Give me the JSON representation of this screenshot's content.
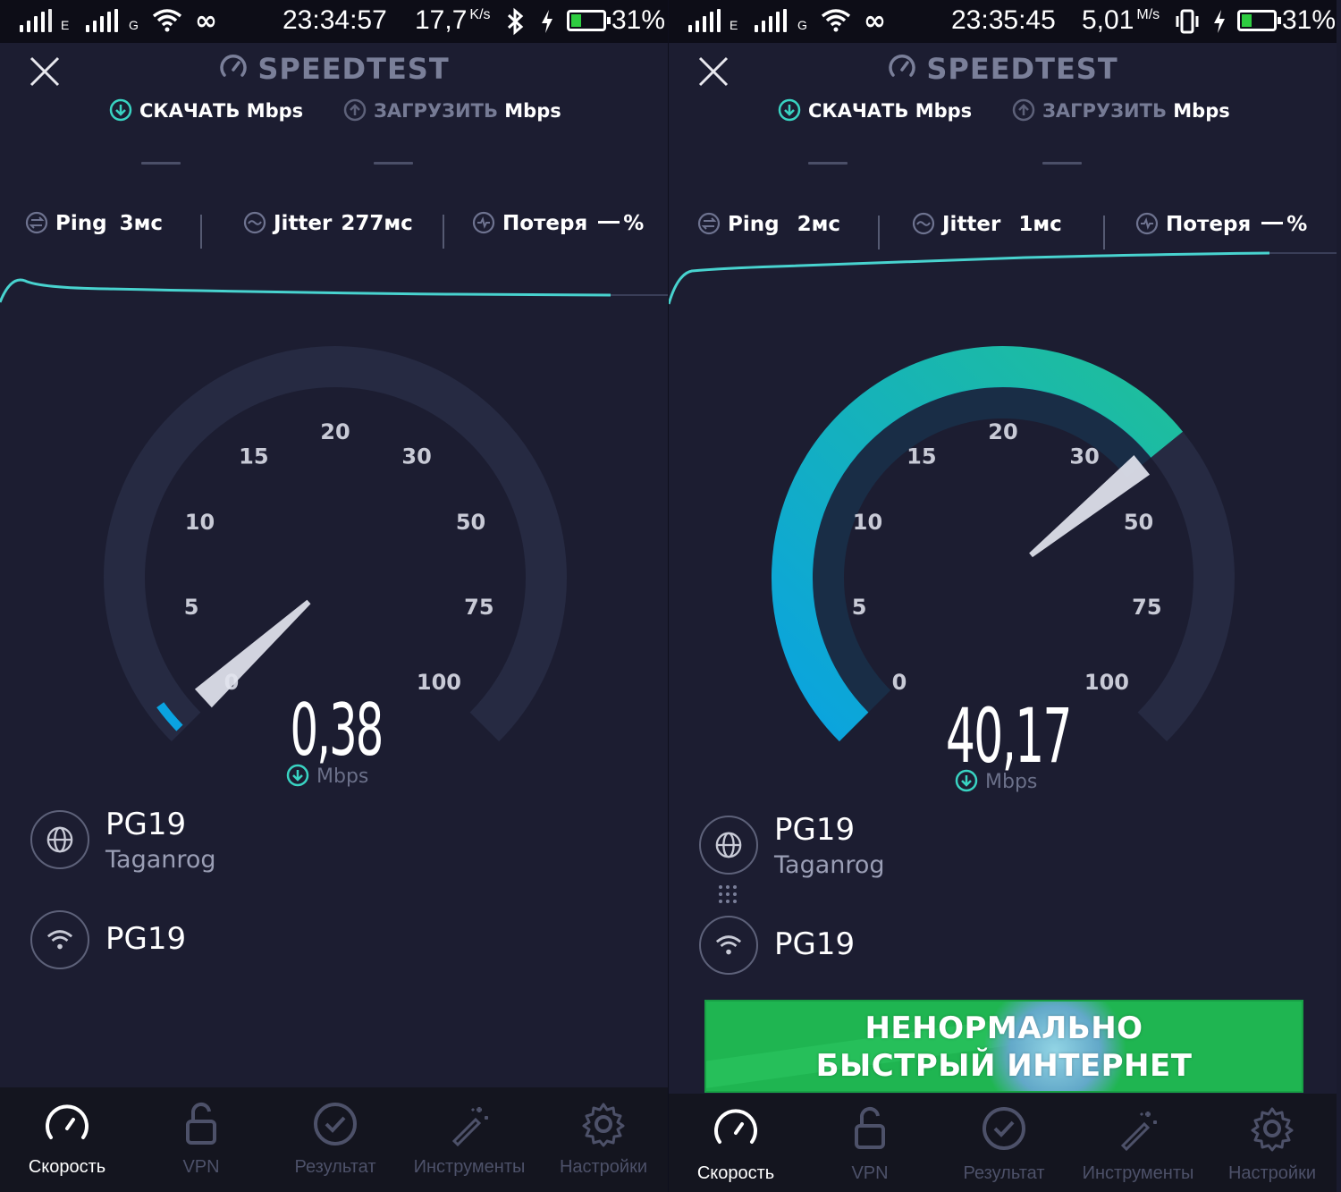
{
  "screens": [
    {
      "status": {
        "net1": "E",
        "net2": "G",
        "time": "23:34:57",
        "speed_value": "17,7",
        "speed_unit": "K/s",
        "battery": "31%"
      },
      "title": "SPEEDTEST",
      "tabs": {
        "download": {
          "label": "СКАЧАТЬ",
          "unit": "Mbps"
        },
        "upload": {
          "label": "ЗАГРУЗИТЬ",
          "unit": "Mbps"
        }
      },
      "metrics": {
        "ping": {
          "label": "Ping",
          "value": "3мс"
        },
        "jitter": {
          "label": "Jitter",
          "value": "277мс"
        },
        "loss": {
          "label": "Потеря",
          "value": "%"
        }
      },
      "gauge": {
        "ticks": [
          "0",
          "5",
          "10",
          "15",
          "20",
          "30",
          "50",
          "75",
          "100"
        ],
        "speed": "0,38",
        "unit": "Mbps",
        "level_mbps": 0.38
      },
      "server": {
        "name": "PG19",
        "location": "Taganrog"
      },
      "network": {
        "name": "PG19"
      }
    },
    {
      "status": {
        "net1": "E",
        "net2": "G",
        "time": "23:35:45",
        "speed_value": "5,01",
        "speed_unit": "M/s",
        "battery": "31%"
      },
      "title": "SPEEDTEST",
      "tabs": {
        "download": {
          "label": "СКАЧАТЬ",
          "unit": "Mbps"
        },
        "upload": {
          "label": "ЗАГРУЗИТЬ",
          "unit": "Mbps"
        }
      },
      "metrics": {
        "ping": {
          "label": "Ping",
          "value": "2мс"
        },
        "jitter": {
          "label": "Jitter",
          "value": "1мс"
        },
        "loss": {
          "label": "Потеря",
          "value": "%"
        }
      },
      "gauge": {
        "ticks": [
          "0",
          "5",
          "10",
          "15",
          "20",
          "30",
          "50",
          "75",
          "100"
        ],
        "speed": "40,17",
        "unit": "Mbps",
        "level_mbps": 40.17
      },
      "server": {
        "name": "PG19",
        "location": "Taganrog"
      },
      "network": {
        "name": "PG19"
      },
      "banner": {
        "line1": "НЕНОРМАЛЬНО",
        "line2": "БЫСТРЫЙ ИНТЕРНЕТ"
      }
    }
  ],
  "nav": [
    "Скорость",
    "VPN",
    "Результат",
    "Инструменты",
    "Настройки"
  ],
  "colors": {
    "background": "#1c1d31",
    "gauge_track": "#262a42",
    "accent_blue": "#0aa3e0",
    "accent_teal": "#1fbf9a",
    "graph_line": "#48d3cf",
    "banner_green": "#1fb551"
  }
}
